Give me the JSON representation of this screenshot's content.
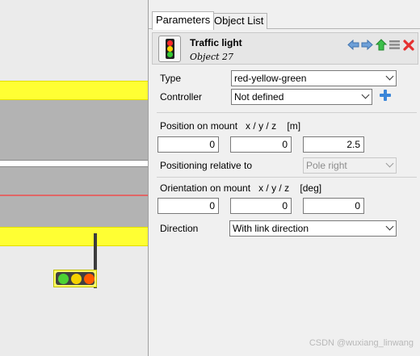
{
  "tabs": {
    "parameters": "Parameters",
    "object_list": "Object List"
  },
  "object": {
    "title": "Traffic light",
    "subtitle": "Object 27"
  },
  "header_icons": [
    "arrow-left-icon",
    "arrow-right-icon",
    "arrow-up-icon",
    "list-icon",
    "delete-icon"
  ],
  "fields": {
    "type_label": "Type",
    "type_value": "red-yellow-green",
    "controller_label": "Controller",
    "controller_value": "Not defined",
    "position_label": "Position on mount   x / y / z    [m]",
    "position_x": "0",
    "position_y": "0",
    "position_z": "2.5",
    "relpos_label": "Positioning relative to",
    "relpos_value": "Pole right",
    "orientation_label": "Orientation on mount   x / y / z    [deg]",
    "orient_x": "0",
    "orient_y": "0",
    "orient_z": "0",
    "direction_label": "Direction",
    "direction_value": "With link direction"
  },
  "watermark": "CSDN @wuxiang_linwang",
  "colors": {
    "lane_yellow": "#ffff33",
    "lane_gray": "#b3b3b3",
    "accent_blue": "#3b86d8",
    "delete_red": "#e53030",
    "up_green": "#2fa83a"
  }
}
